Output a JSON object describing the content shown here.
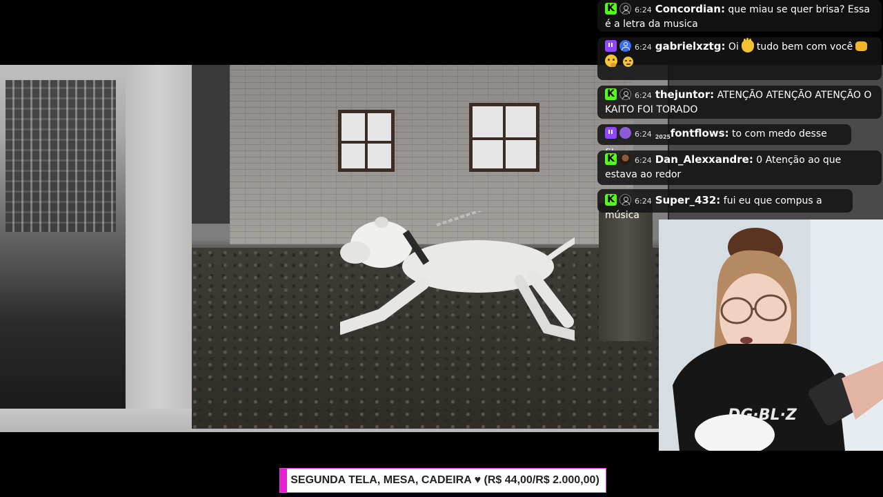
{
  "chat": {
    "messages": [
      {
        "badges": [
          "kick-badge"
        ],
        "avatar": "default-avatar-icon",
        "time": "6:24",
        "user": "Concordian:",
        "text": "que miau se quer brisa? Essa é a letra da musica"
      },
      {
        "badges": [
          "twitch-badge"
        ],
        "avatar": "blue-avatar-icon",
        "time": "6:24",
        "user": "gabrielxztg:",
        "text_parts": [
          "Oi",
          "tudo bem com você"
        ],
        "emotes": [
          "waving-hand-emoji",
          "fist-bump-emoji",
          "thinking-face-emoji",
          "smirk-face-emoji"
        ]
      },
      {
        "badges": [
          "kick-badge"
        ],
        "avatar": "default-avatar-icon",
        "time": "6:24",
        "user": "thejuntor:",
        "text": "ATENÇÃO ATENÇÃO ATENÇÃO O KAITO FOI TORADO"
      },
      {
        "badges": [
          "twitch-badge"
        ],
        "avatar": "purple-avatar-icon",
        "badge_2025": "2025",
        "time": "6:24",
        "user": "fontflows:",
        "text": "to com medo desse filme"
      },
      {
        "badges": [
          "kick-badge"
        ],
        "avatar": "photo-avatar-icon",
        "time": "6:24",
        "user": "Dan_Alexxandre:",
        "text": "0 Atenção ao que estava ao redor"
      },
      {
        "badges": [
          "kick-badge"
        ],
        "avatar": "default-avatar-icon",
        "time": "6:24",
        "user": "Super_432:",
        "text": "fui eu que compus a música"
      }
    ]
  },
  "goal": {
    "text": "SEGUNDA TELA, MESA, CADEIRA ♥ (R$ 44,00/R$ 2.000,00)",
    "current": 44,
    "target": 2000,
    "progress_fraction": 0.022,
    "fill_color": "#e51fd2",
    "border_color": "#e545d8"
  },
  "colors": {
    "kick_green": "#53fc18",
    "twitch_purple": "#9146ff",
    "chat_bg": "rgba(20,20,22,0.88)"
  }
}
